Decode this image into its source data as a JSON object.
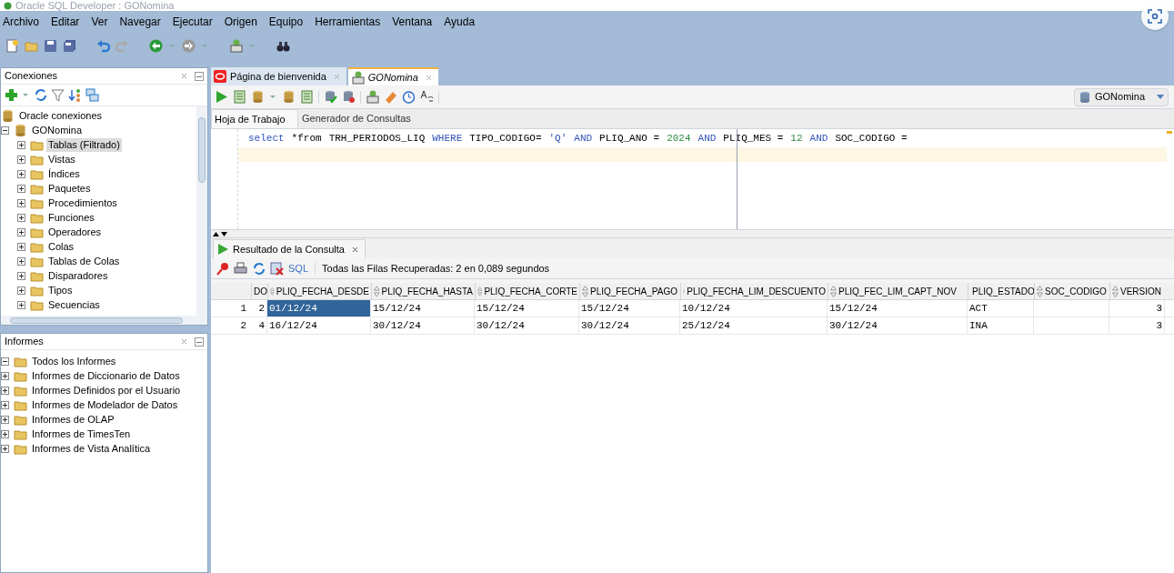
{
  "window": {
    "title": "Oracle SQL Developer : GONomina"
  },
  "menu": [
    "Archivo",
    "Editar",
    "Ver",
    "Navegar",
    "Ejecutar",
    "Origen",
    "Equipo",
    "Herramientas",
    "Ventana",
    "Ayuda"
  ],
  "connections_panel": {
    "title": "Conexiones",
    "tree": [
      {
        "label": "Oracle conexiones",
        "selected": false,
        "children": [
          {
            "label": "GONomina",
            "selected": false,
            "expanded": true,
            "children": [
              {
                "label": "Tablas (Filtrado)",
                "selected": true,
                "expanded": false
              },
              {
                "label": "Vistas",
                "selected": false,
                "expanded": false
              },
              {
                "label": "Índices",
                "selected": false,
                "expanded": false
              },
              {
                "label": "Paquetes",
                "selected": false,
                "expanded": false
              },
              {
                "label": "Procedimientos",
                "selected": false,
                "expanded": false
              },
              {
                "label": "Funciones",
                "selected": false,
                "expanded": false
              },
              {
                "label": "Operadores",
                "selected": false,
                "expanded": false
              },
              {
                "label": "Colas",
                "selected": false,
                "expanded": false
              },
              {
                "label": "Tablas de Colas",
                "selected": false,
                "expanded": false
              },
              {
                "label": "Disparadores",
                "selected": false,
                "expanded": false
              },
              {
                "label": "Tipos",
                "selected": false,
                "expanded": false
              },
              {
                "label": "Secuencias",
                "selected": false,
                "expanded": false
              }
            ]
          }
        ]
      }
    ]
  },
  "reports_panel": {
    "title": "Informes",
    "tree": [
      {
        "label": "Todos los Informes",
        "selected": false,
        "expanded": true,
        "children": [
          {
            "label": "Informes de Diccionario de Datos",
            "selected": false,
            "expanded": false
          },
          {
            "label": "Informes Definidos por el Usuario",
            "selected": false,
            "expanded": false
          },
          {
            "label": "Informes de Modelador de Datos",
            "selected": false,
            "expanded": false
          },
          {
            "label": "Informes de OLAP",
            "selected": false,
            "expanded": false
          },
          {
            "label": "Informes de TimesTen",
            "selected": false,
            "expanded": false
          },
          {
            "label": "Informes de Vista Analítica",
            "selected": false,
            "expanded": false
          }
        ]
      }
    ]
  },
  "editor_tabs": [
    {
      "label": "Página de bienvenida",
      "selected": false
    },
    {
      "label": "GONomina",
      "selected": true
    }
  ],
  "connection_selector": "GONomina",
  "worksheet_tabs": [
    {
      "label": "Hoja de Trabajo",
      "selected": true
    },
    {
      "label": "Generador de Consultas",
      "selected": false
    }
  ],
  "sql": [
    {
      "text": "select",
      "kind": "keyword"
    },
    {
      "text": "*from",
      "kind": "plain"
    },
    {
      "text": "TRH_PERIODOS_LIQ",
      "kind": "plain"
    },
    {
      "text": "WHERE",
      "kind": "keyword"
    },
    {
      "text": "TIPO_CODIGO=",
      "kind": "plain"
    },
    {
      "text": "'Q'",
      "kind": "string"
    },
    {
      "text": "AND",
      "kind": "keyword"
    },
    {
      "text": "PLIQ_ANO =",
      "kind": "plain"
    },
    {
      "text": "2024",
      "kind": "number"
    },
    {
      "text": "AND",
      "kind": "keyword"
    },
    {
      "text": "PLIQ_MES =",
      "kind": "plain"
    },
    {
      "text": "12",
      "kind": "number"
    },
    {
      "text": "AND",
      "kind": "keyword"
    },
    {
      "text": "SOC_CODIGO =",
      "kind": "plain"
    }
  ],
  "results_tab": {
    "label": "Resultado de la Consulta"
  },
  "results_toolbar": {
    "sql_link": "SQL",
    "status": "Todas las Filas Recuperadas: 2 en 0,089 segundos"
  },
  "table": {
    "columns": [
      "DO",
      "PLIQ_FECHA_DESDE",
      "PLIQ_FECHA_HASTA",
      "PLIQ_FECHA_CORTE",
      "PLIQ_FECHA_PAGO",
      "PLIQ_FECHA_LIM_DESCUENTO",
      "PLIQ_FEC_LIM_CAPT_NOV",
      "PLIQ_ESTADO",
      "SOC_CODIGO",
      "VERSION"
    ],
    "rows": [
      {
        "number": "1",
        "cells": [
          {
            "text": "2",
            "selected": false
          },
          {
            "text": "01/12/24",
            "selected": true
          },
          {
            "text": "15/12/24",
            "selected": false
          },
          {
            "text": "15/12/24",
            "selected": false
          },
          {
            "text": "15/12/24",
            "selected": false
          },
          {
            "text": "10/12/24",
            "selected": false
          },
          {
            "text": "15/12/24",
            "selected": false
          },
          {
            "text": "ACT",
            "selected": false
          },
          {
            "text": "",
            "selected": false
          },
          {
            "text": "3",
            "selected": false
          }
        ]
      },
      {
        "number": "2",
        "cells": [
          {
            "text": "4",
            "selected": false
          },
          {
            "text": "16/12/24",
            "selected": false
          },
          {
            "text": "30/12/24",
            "selected": false
          },
          {
            "text": "30/12/24",
            "selected": false
          },
          {
            "text": "30/12/24",
            "selected": false
          },
          {
            "text": "25/12/24",
            "selected": false
          },
          {
            "text": "30/12/24",
            "selected": false
          },
          {
            "text": "INA",
            "selected": false
          },
          {
            "text": "",
            "selected": false
          },
          {
            "text": "3",
            "selected": false
          }
        ]
      }
    ]
  }
}
